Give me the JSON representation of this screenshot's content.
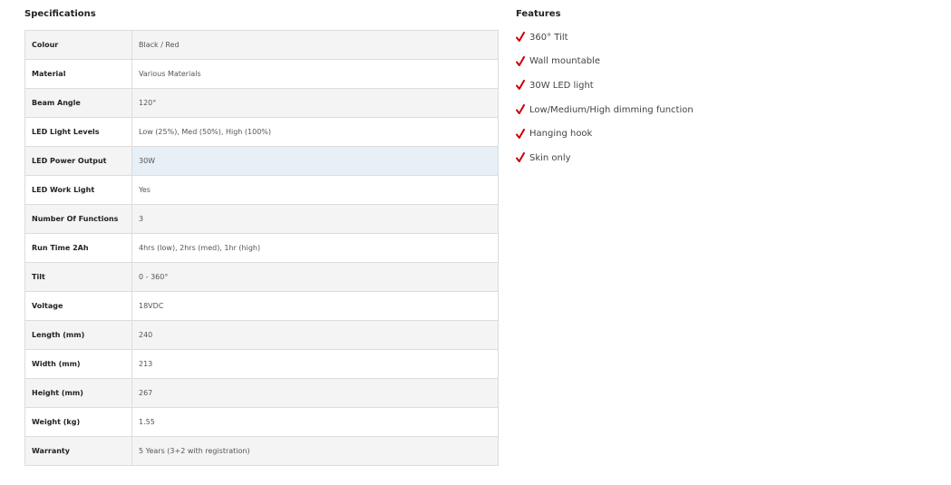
{
  "specifications": {
    "title": "Specifications",
    "rows": [
      {
        "label": "Colour",
        "value": "Black / Red"
      },
      {
        "label": "Material",
        "value": "Various Materials"
      },
      {
        "label": "Beam Angle",
        "value": "120°"
      },
      {
        "label": "LED Light Levels",
        "value": "Low (25%), Med (50%), High (100%)"
      },
      {
        "label": "LED Power Output",
        "value": "30W"
      },
      {
        "label": "LED Work Light",
        "value": "Yes"
      },
      {
        "label": "Number Of Functions",
        "value": "3"
      },
      {
        "label": "Run Time 2Ah",
        "value": "4hrs (low), 2hrs (med), 1hr (high)"
      },
      {
        "label": "Tilt",
        "value": "0 - 360°"
      },
      {
        "label": "Voltage",
        "value": "18VDC"
      },
      {
        "label": "Length (mm)",
        "value": "240"
      },
      {
        "label": "Width (mm)",
        "value": "213"
      },
      {
        "label": "Height (mm)",
        "value": "267"
      },
      {
        "label": "Weight (kg)",
        "value": "1.55"
      },
      {
        "label": "Warranty",
        "value": "5 Years (3+2 with registration)"
      }
    ]
  },
  "features": {
    "title": "Features",
    "items": [
      "360° Tilt",
      "Wall mountable",
      "30W LED light",
      "Low/Medium/High dimming function",
      "Hanging hook",
      "Skin only"
    ]
  },
  "colors": {
    "check": "#cc0000",
    "highlight_row": "#e6f0f6"
  },
  "icons": {
    "feature_bullet": "check-icon"
  }
}
